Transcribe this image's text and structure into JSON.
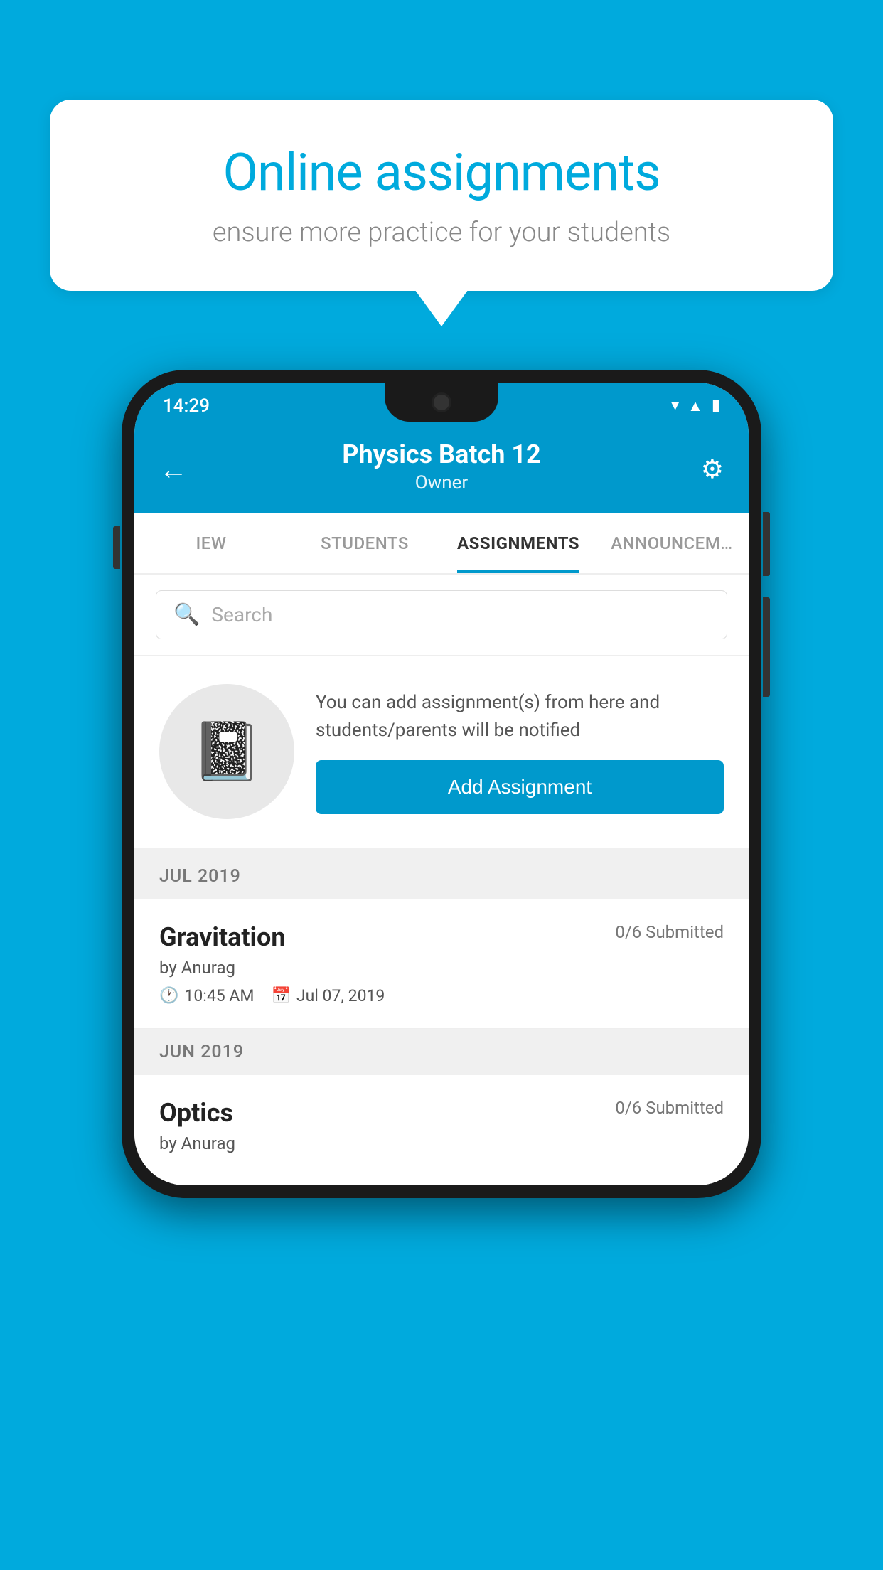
{
  "background_color": "#00AADD",
  "bubble": {
    "title": "Online assignments",
    "subtitle": "ensure more practice for your students"
  },
  "status_bar": {
    "time": "14:29",
    "icons": [
      "wifi",
      "signal",
      "battery"
    ]
  },
  "header": {
    "title": "Physics Batch 12",
    "subtitle": "Owner",
    "back_label": "←",
    "settings_label": "⚙"
  },
  "tabs": [
    {
      "label": "IEW",
      "active": false
    },
    {
      "label": "STUDENTS",
      "active": false
    },
    {
      "label": "ASSIGNMENTS",
      "active": true
    },
    {
      "label": "ANNOUNCEM…",
      "active": false
    }
  ],
  "search": {
    "placeholder": "Search"
  },
  "assignment_prompt": {
    "description": "You can add assignment(s) from here and students/parents will be notified",
    "button_label": "Add Assignment"
  },
  "months": [
    {
      "label": "JUL 2019",
      "assignments": [
        {
          "title": "Gravitation",
          "submitted": "0/6 Submitted",
          "by": "by Anurag",
          "time": "10:45 AM",
          "date": "Jul 07, 2019"
        }
      ]
    },
    {
      "label": "JUN 2019",
      "assignments": [
        {
          "title": "Optics",
          "submitted": "0/6 Submitted",
          "by": "by Anurag",
          "time": "",
          "date": ""
        }
      ]
    }
  ]
}
